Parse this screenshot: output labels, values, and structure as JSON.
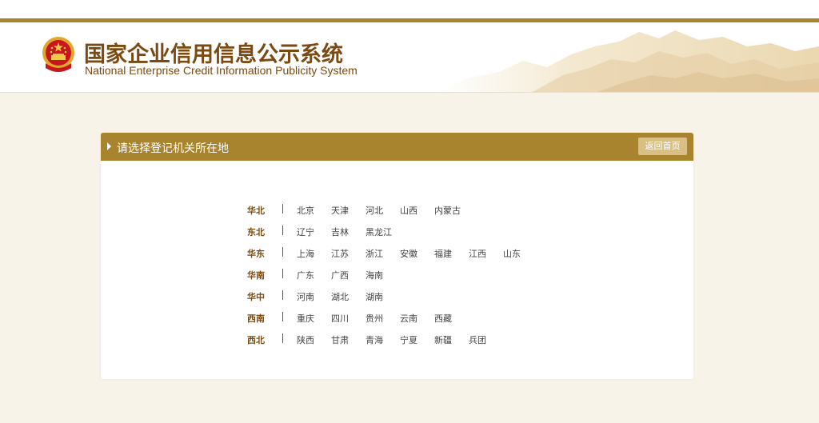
{
  "header": {
    "title_cn": "国家企业信用信息公示系统",
    "title_en": "National Enterprise Credit Information Publicity System",
    "brand_color": "#a9842f"
  },
  "panel": {
    "title": "请选择登记机关所在地",
    "home_button": "返回首页"
  },
  "regions": [
    {
      "name": "华北",
      "provinces": [
        "北京",
        "天津",
        "河北",
        "山西",
        "内蒙古"
      ]
    },
    {
      "name": "东北",
      "provinces": [
        "辽宁",
        "吉林",
        "黑龙江"
      ]
    },
    {
      "name": "华东",
      "provinces": [
        "上海",
        "江苏",
        "浙江",
        "安徽",
        "福建",
        "江西",
        "山东"
      ]
    },
    {
      "name": "华南",
      "provinces": [
        "广东",
        "广西",
        "海南"
      ]
    },
    {
      "name": "华中",
      "provinces": [
        "河南",
        "湖北",
        "湖南"
      ]
    },
    {
      "name": "西南",
      "provinces": [
        "重庆",
        "四川",
        "贵州",
        "云南",
        "西藏"
      ]
    },
    {
      "name": "西北",
      "provinces": [
        "陕西",
        "甘肃",
        "青海",
        "宁夏",
        "新疆",
        "兵团"
      ]
    }
  ]
}
